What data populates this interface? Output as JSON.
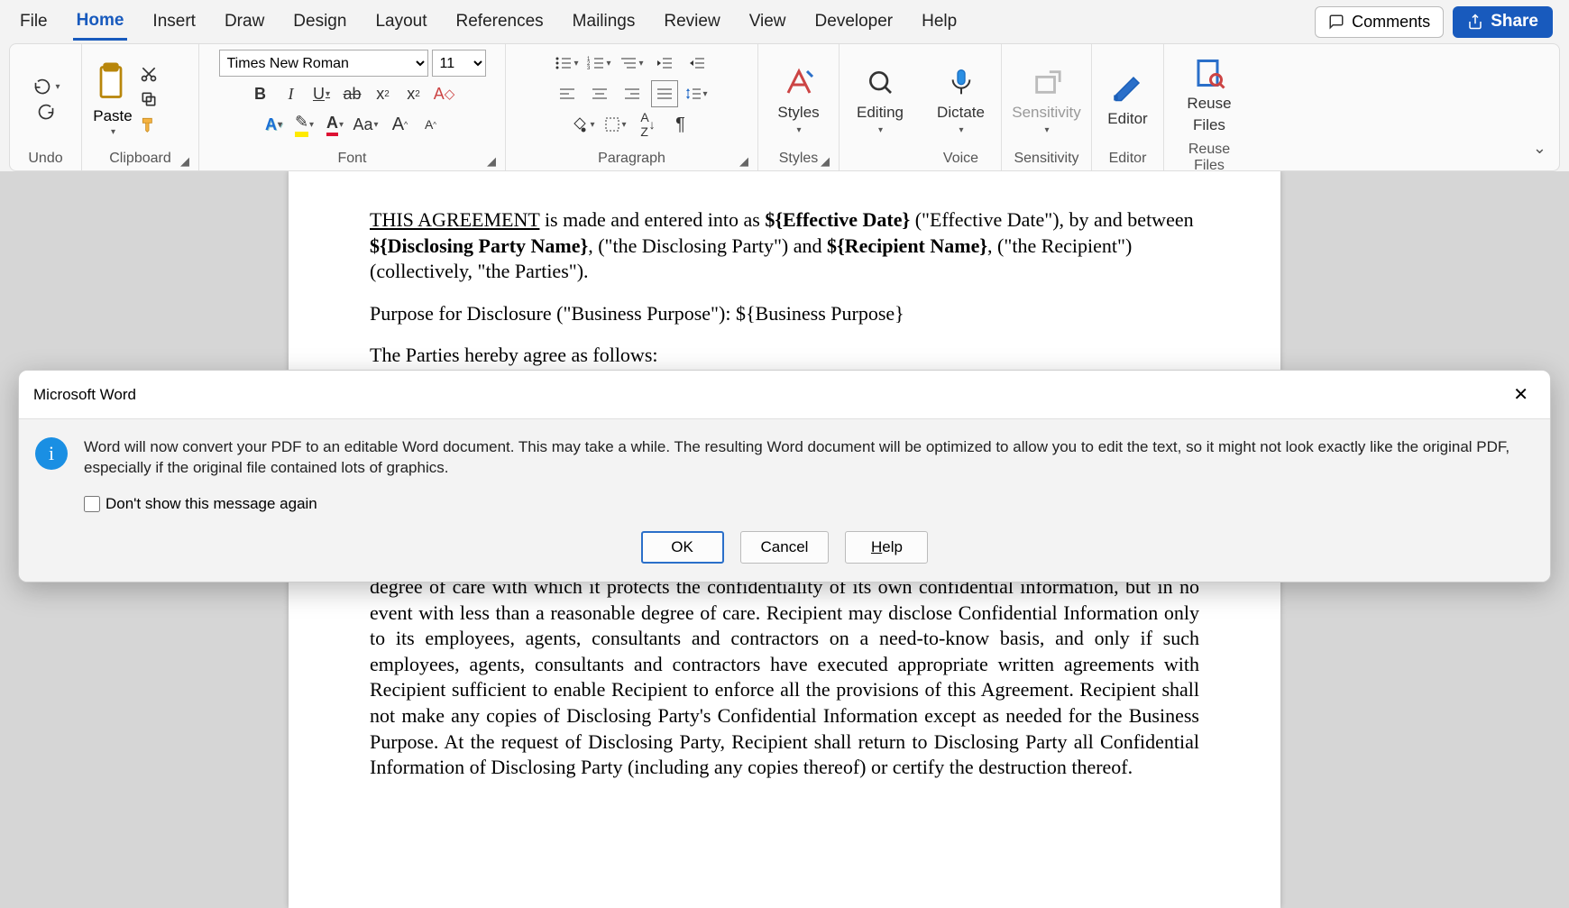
{
  "tabs": {
    "file": "File",
    "home": "Home",
    "insert": "Insert",
    "draw": "Draw",
    "design": "Design",
    "layout": "Layout",
    "references": "References",
    "mailings": "Mailings",
    "review": "Review",
    "view": "View",
    "developer": "Developer",
    "help": "Help"
  },
  "topright": {
    "comments": "Comments",
    "share": "Share"
  },
  "ribbon": {
    "undo_label": "Undo",
    "clipboard_label": "Clipboard",
    "paste": "Paste",
    "font_label": "Font",
    "font_name": "Times New Roman",
    "font_size": "11",
    "paragraph_label": "Paragraph",
    "styles_label": "Styles",
    "styles_btn": "Styles",
    "editing_btn": "Editing",
    "dictate_btn": "Dictate",
    "sensitivity_btn": "Sensitivity",
    "editor_btn": "Editor",
    "reuse_btn1": "Reuse",
    "reuse_btn2": "Files",
    "voice_label": "Voice",
    "sensitivity_label": "Sensitivity",
    "editor_label": "Editor",
    "reuse_label": "Reuse Files"
  },
  "document": {
    "this_agreement": "THIS AGREEMENT",
    "para1_a": " is made and entered into as ",
    "eff_date_var": "${Effective Date}",
    "para1_b": " (\"Effective Date\"), by and between ",
    "disc_party_var": "${Disclosing Party Name}",
    "para1_c": ", (\"the Disclosing Party\") and ",
    "recip_var": "${Recipient Name}",
    "para1_d": ", (\"the Recipient\") (collectively, \"the Parties\").",
    "para2_a": "Purpose for Disclosure (\"Business Purpose\"): ",
    "bp_var": "${Business Purpose}",
    "para3": "The Parties hereby agree as follows:",
    "para4": "degree of care with which it protects the confidentiality of its own confidential information, but in no event with less than a reasonable degree of care. Recipient may disclose Confidential Information only to its employees, agents, consultants and contractors on a need-to-know basis, and only if such employees, agents, consultants and contractors have executed appropriate written agreements with Recipient sufficient to enable Recipient to enforce all the provisions of this Agreement. Recipient shall not make any copies of Disclosing Party's Confidential Information except as needed for the Business Purpose. At the request of Disclosing Party, Recipient shall return to Disclosing Party all Confidential Information of Disclosing Party (including any copies thereof) or certify the destruction thereof."
  },
  "dialog": {
    "title": "Microsoft Word",
    "message": "Word will now convert your PDF to an editable Word document. This may take a while. The resulting Word document will be optimized to allow you to edit the text, so it might not look exactly like the original PDF, especially if the original file contained lots of graphics.",
    "checkbox": "Don't show this message again",
    "ok": "OK",
    "cancel": "Cancel",
    "help": "Help"
  }
}
